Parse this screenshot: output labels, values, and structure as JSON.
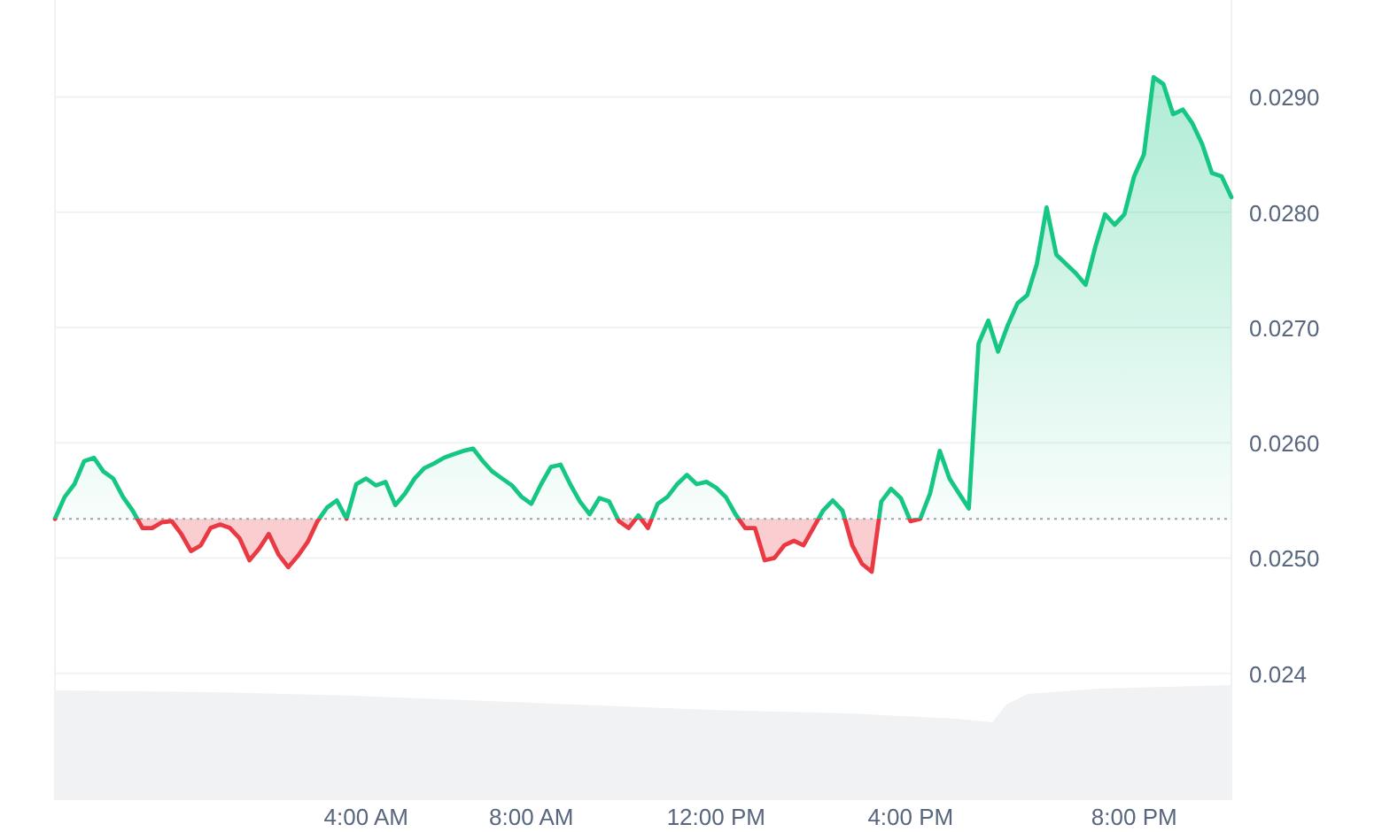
{
  "chart_data": {
    "type": "area",
    "grid": true,
    "categories": [
      null,
      null,
      null,
      null,
      null,
      null,
      null,
      null,
      null,
      null,
      null,
      null,
      null,
      null,
      null,
      null,
      null,
      null,
      null,
      null,
      null,
      null,
      null,
      null,
      null,
      null,
      null,
      null,
      null,
      null,
      null,
      null,
      "4:00 AM",
      null,
      null,
      null,
      null,
      null,
      null,
      null,
      null,
      null,
      null,
      null,
      null,
      null,
      null,
      null,
      null,
      "8:00 AM",
      null,
      null,
      null,
      null,
      null,
      null,
      null,
      null,
      null,
      null,
      null,
      null,
      null,
      null,
      null,
      null,
      null,
      null,
      "12:00 PM",
      null,
      null,
      null,
      null,
      null,
      null,
      null,
      null,
      null,
      null,
      null,
      null,
      null,
      null,
      null,
      null,
      null,
      null,
      null,
      "4:00 PM",
      null,
      null,
      null,
      null,
      null,
      null,
      null,
      null,
      null,
      null,
      null,
      null,
      null,
      null,
      null,
      null,
      null,
      null,
      null,
      null,
      null,
      null,
      "8:00 PM",
      null,
      null,
      null,
      null,
      null,
      null,
      null,
      null,
      null,
      null
    ],
    "series": [
      {
        "color": "#16c784",
        "values": [
          0.02534,
          0.02553,
          0.02564,
          0.02584,
          0.02587,
          0.02575,
          0.02569,
          0.02553,
          0.02541,
          0.02526,
          0.02526,
          0.02531,
          0.02532,
          0.02521,
          0.02506,
          0.02511,
          0.02526,
          0.02529,
          0.02526,
          0.02517,
          0.02498,
          0.02508,
          0.02521,
          0.02503,
          0.02492,
          0.02502,
          0.02514,
          0.02532,
          0.02544,
          0.0255,
          0.02534,
          0.02564,
          0.02569,
          0.02563,
          0.02566,
          0.02546,
          0.02556,
          0.02569,
          0.02578,
          0.02582,
          0.02587,
          0.0259,
          0.02593,
          0.02595,
          0.02584,
          0.02575,
          0.02569,
          0.02563,
          0.02553,
          0.02547,
          0.02564,
          0.02579,
          0.02581,
          0.02564,
          0.02549,
          0.02538,
          0.02552,
          0.02549,
          0.02532,
          0.02526,
          0.02537,
          0.02526,
          0.02547,
          0.02553,
          0.02564,
          0.02572,
          0.02564,
          0.02566,
          0.02561,
          0.02553,
          0.02538,
          0.02526,
          0.02526,
          0.02498,
          0.025,
          0.02511,
          0.02515,
          0.02511,
          0.02526,
          0.02541,
          0.0255,
          0.02541,
          0.02511,
          0.02495,
          0.02488,
          0.02549,
          0.0256,
          0.02552,
          0.02532,
          0.02534,
          0.02556,
          0.02593,
          0.02569,
          0.02556,
          0.02543,
          0.02686,
          0.02706,
          0.02679,
          0.02702,
          0.02721,
          0.02728,
          0.02755,
          0.02804,
          0.02763,
          0.02755,
          0.02747,
          0.02737,
          0.0277,
          0.02798,
          0.02789,
          0.02798,
          0.02831,
          0.0285,
          0.02917,
          0.02911,
          0.02885,
          0.02889,
          0.02877,
          0.02859,
          0.02834,
          0.02831,
          0.02813
        ]
      }
    ],
    "ylim": [
      0.0229,
      0.02984
    ],
    "yticks": [
      {
        "value": 0.029,
        "label": "0.0290"
      },
      {
        "value": 0.028,
        "label": "0.0280"
      },
      {
        "value": 0.027,
        "label": "0.0270"
      },
      {
        "value": 0.026,
        "label": "0.0260"
      },
      {
        "value": 0.025,
        "label": "0.0250"
      },
      {
        "value": 0.024,
        "label": "0.024"
      }
    ],
    "ref_lines": [
      {
        "axis": "y",
        "value": 0.02534
      }
    ]
  }
}
